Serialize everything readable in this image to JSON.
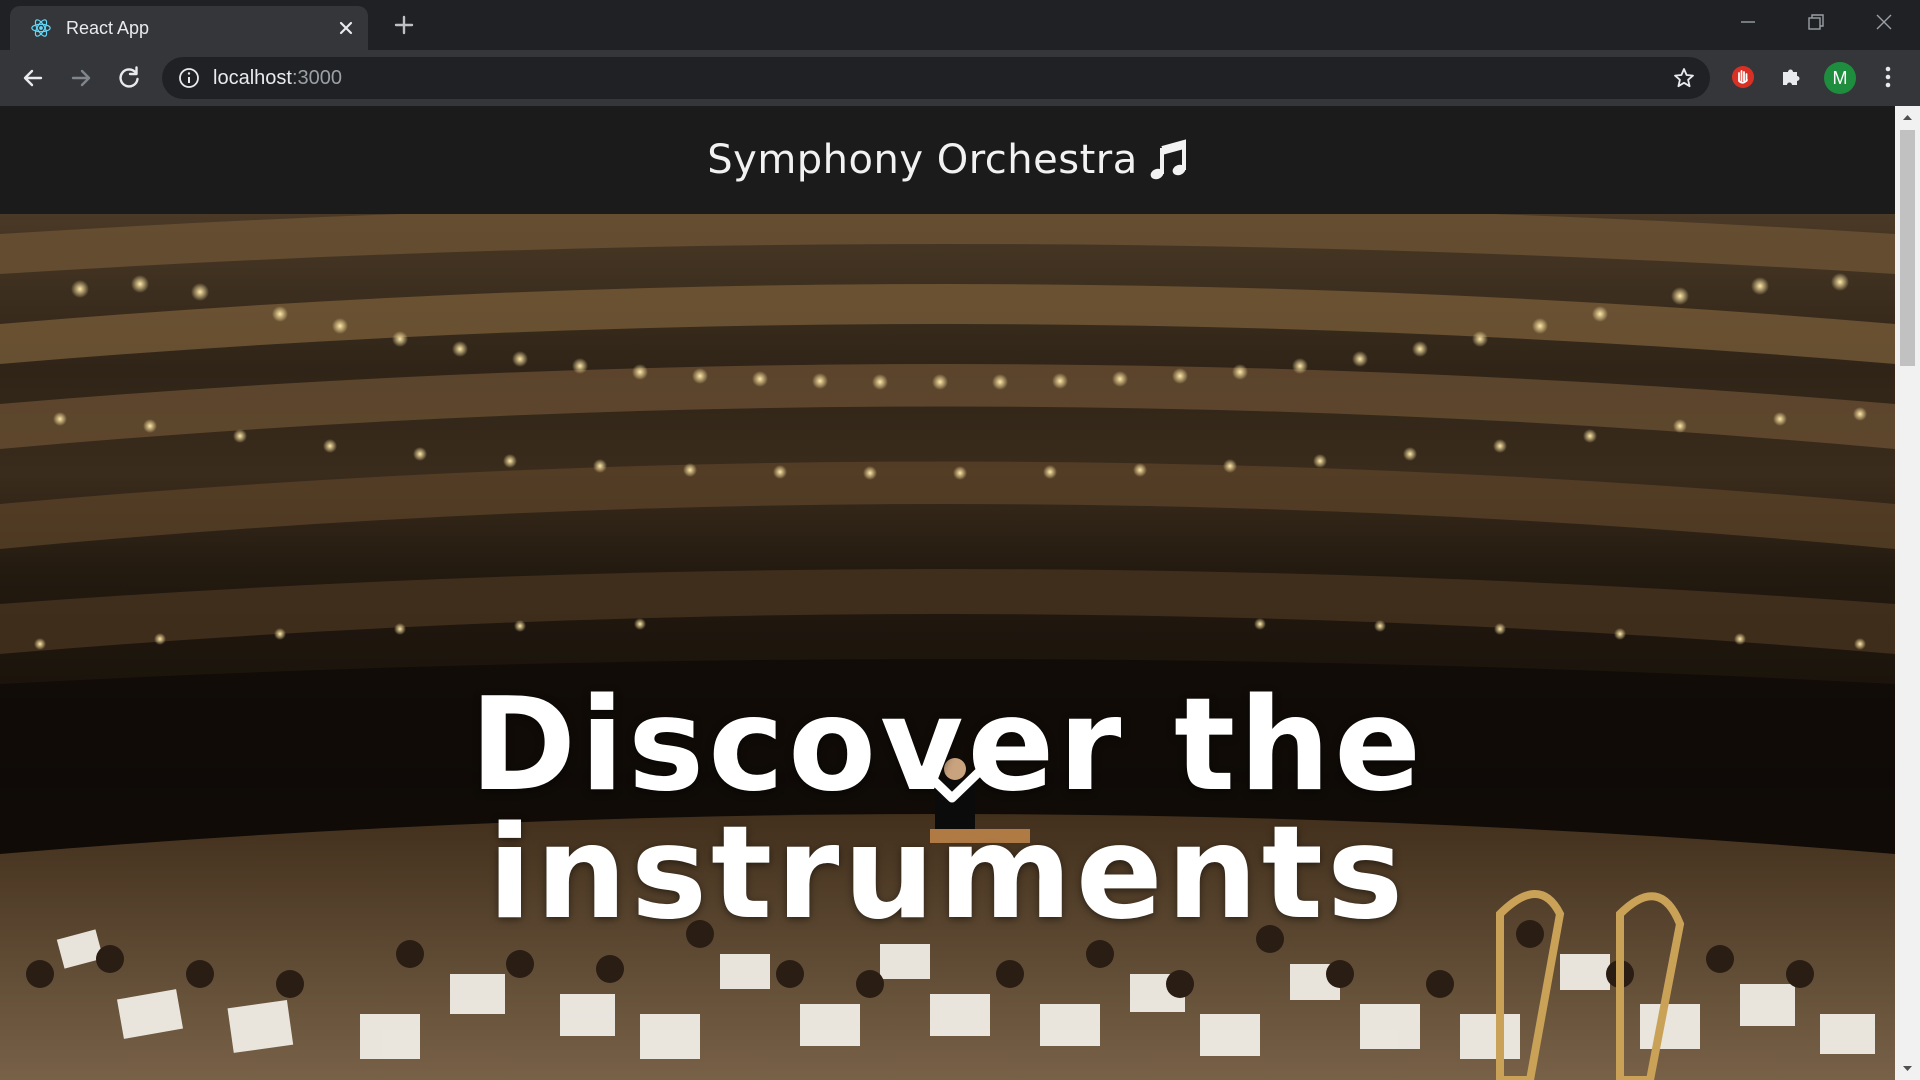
{
  "browser": {
    "tab_title": "React App",
    "url_host": "localhost",
    "url_port": ":3000",
    "profile_initial": "M",
    "icons": [
      "react-favicon-icon",
      "close-icon",
      "plus-icon",
      "minimize-icon",
      "restore-icon",
      "close-window-icon",
      "back-arrow-icon",
      "forward-arrow-icon",
      "reload-icon",
      "info-icon",
      "star-icon",
      "extension-shield-icon",
      "puzzle-icon",
      "menu-dots-icon"
    ]
  },
  "header": {
    "title": "Symphony Orchestra",
    "icon": "music-note-icon"
  },
  "hero": {
    "headline": "Discover the instruments",
    "scroll_icon": "chevron-down-icon"
  },
  "colors": {
    "header_bg": "#1b1b1b",
    "chrome_bg": "#202124",
    "toolbar_bg": "#35363a",
    "avatar_bg": "#1e8e3e"
  }
}
